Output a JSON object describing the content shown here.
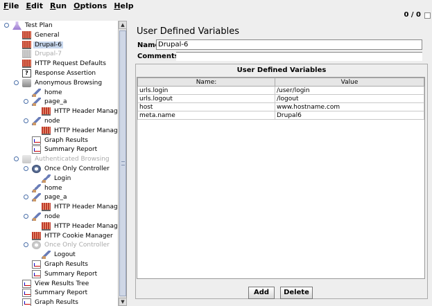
{
  "menu": {
    "items": [
      {
        "name": "File",
        "key": "F",
        "rest": "ile"
      },
      {
        "name": "Edit",
        "key": "E",
        "rest": "dit"
      },
      {
        "name": "Run",
        "key": "R",
        "rest": "un"
      },
      {
        "name": "Options",
        "key": "O",
        "rest": "ptions"
      },
      {
        "name": "Help",
        "key": "H",
        "rest": "elp"
      }
    ]
  },
  "toolbar": {
    "error_count": "0 / 0"
  },
  "tree": {
    "items": [
      {
        "label": "Test Plan",
        "icon": "test-plan-icon",
        "kind": "plan",
        "level": 0,
        "toggle": "expanded",
        "disabled": false,
        "selected": false
      },
      {
        "label": "General",
        "icon": "config-element-icon",
        "kind": "config",
        "level": 1,
        "toggle": "",
        "disabled": false,
        "selected": false
      },
      {
        "label": "Drupal-6",
        "icon": "config-element-icon",
        "kind": "config",
        "level": 1,
        "toggle": "",
        "disabled": false,
        "selected": true
      },
      {
        "label": "Drupal-7",
        "icon": "config-element-icon",
        "kind": "config",
        "level": 1,
        "toggle": "",
        "disabled": true,
        "selected": false
      },
      {
        "label": "HTTP Request Defaults",
        "icon": "config-element-icon",
        "kind": "config",
        "level": 1,
        "toggle": "",
        "disabled": false,
        "selected": false
      },
      {
        "label": "Response Assertion",
        "icon": "assertion-icon",
        "kind": "assert",
        "level": 1,
        "toggle": "",
        "disabled": false,
        "selected": false
      },
      {
        "label": "Anonymous Browsing",
        "icon": "thread-group-icon",
        "kind": "thread",
        "level": 1,
        "toggle": "expanded",
        "disabled": false,
        "selected": false
      },
      {
        "label": "home",
        "icon": "sampler-icon",
        "kind": "sampler",
        "level": 2,
        "toggle": "",
        "disabled": false,
        "selected": false
      },
      {
        "label": "page_a",
        "icon": "sampler-icon",
        "kind": "sampler",
        "level": 2,
        "toggle": "expanded",
        "disabled": false,
        "selected": false
      },
      {
        "label": "HTTP Header Manager",
        "icon": "config-element-icon",
        "kind": "config",
        "level": 3,
        "toggle": "",
        "disabled": false,
        "selected": false
      },
      {
        "label": "node",
        "icon": "sampler-icon",
        "kind": "sampler",
        "level": 2,
        "toggle": "expanded",
        "disabled": false,
        "selected": false
      },
      {
        "label": "HTTP Header Manager",
        "icon": "config-element-icon",
        "kind": "config",
        "level": 3,
        "toggle": "",
        "disabled": false,
        "selected": false
      },
      {
        "label": "Graph Results",
        "icon": "listener-icon",
        "kind": "listener",
        "level": 2,
        "toggle": "",
        "disabled": false,
        "selected": false
      },
      {
        "label": "Summary Report",
        "icon": "listener-icon",
        "kind": "listener",
        "level": 2,
        "toggle": "",
        "disabled": false,
        "selected": false
      },
      {
        "label": "Authenticated Browsing",
        "icon": "thread-group-icon",
        "kind": "thread",
        "level": 1,
        "toggle": "expanded",
        "disabled": true,
        "selected": false
      },
      {
        "label": "Once Only Controller",
        "icon": "controller-icon",
        "kind": "controller",
        "level": 2,
        "toggle": "expanded",
        "disabled": false,
        "selected": false
      },
      {
        "label": "Login",
        "icon": "sampler-icon",
        "kind": "sampler",
        "level": 3,
        "toggle": "",
        "disabled": false,
        "selected": false
      },
      {
        "label": "home",
        "icon": "sampler-icon",
        "kind": "sampler",
        "level": 2,
        "toggle": "",
        "disabled": false,
        "selected": false
      },
      {
        "label": "page_a",
        "icon": "sampler-icon",
        "kind": "sampler",
        "level": 2,
        "toggle": "expanded",
        "disabled": false,
        "selected": false
      },
      {
        "label": "HTTP Header Manager",
        "icon": "config-element-icon",
        "kind": "config",
        "level": 3,
        "toggle": "",
        "disabled": false,
        "selected": false
      },
      {
        "label": "node",
        "icon": "sampler-icon",
        "kind": "sampler",
        "level": 2,
        "toggle": "expanded",
        "disabled": false,
        "selected": false
      },
      {
        "label": "HTTP Header Manager",
        "icon": "config-element-icon",
        "kind": "config",
        "level": 3,
        "toggle": "",
        "disabled": false,
        "selected": false
      },
      {
        "label": "HTTP Cookie Manager",
        "icon": "config-element-icon",
        "kind": "config",
        "level": 2,
        "toggle": "",
        "disabled": false,
        "selected": false
      },
      {
        "label": "Once Only Controller",
        "icon": "controller-icon",
        "kind": "controller",
        "level": 2,
        "toggle": "expanded",
        "disabled": true,
        "selected": false
      },
      {
        "label": "Logout",
        "icon": "sampler-icon",
        "kind": "sampler",
        "level": 3,
        "toggle": "",
        "disabled": false,
        "selected": false
      },
      {
        "label": "Graph Results",
        "icon": "listener-icon",
        "kind": "listener",
        "level": 2,
        "toggle": "",
        "disabled": false,
        "selected": false
      },
      {
        "label": "Summary Report",
        "icon": "listener-icon",
        "kind": "listener",
        "level": 2,
        "toggle": "",
        "disabled": false,
        "selected": false
      },
      {
        "label": "View Results Tree",
        "icon": "listener-icon",
        "kind": "listener",
        "level": 1,
        "toggle": "",
        "disabled": false,
        "selected": false
      },
      {
        "label": "Summary Report",
        "icon": "listener-icon",
        "kind": "listener",
        "level": 1,
        "toggle": "",
        "disabled": false,
        "selected": false
      },
      {
        "label": "Graph Results",
        "icon": "listener-icon",
        "kind": "listener",
        "level": 1,
        "toggle": "",
        "disabled": false,
        "selected": false
      }
    ]
  },
  "panel": {
    "title": "User Defined Variables",
    "name_label": "Name:",
    "name_value": "Drupal-6",
    "comments_label": "Comments:",
    "comments_value": "",
    "table_title": "User Defined Variables",
    "columns": [
      "Name:",
      "Value"
    ],
    "rows": [
      [
        "urls.login",
        "/user/login"
      ],
      [
        "urls.logout",
        "/logout"
      ],
      [
        "host",
        "www.hostname.com"
      ],
      [
        "meta.name",
        "Drupal6"
      ]
    ],
    "add_label": "Add",
    "delete_label": "Delete"
  }
}
